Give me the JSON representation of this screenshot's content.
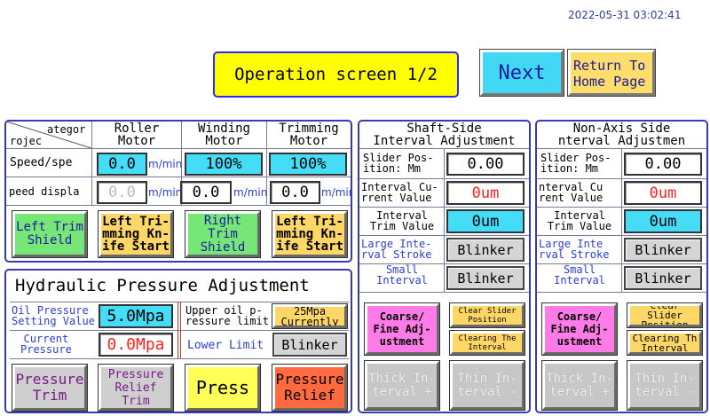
{
  "header": {
    "timestamp": "2022-05-31 03:02:41",
    "title": "Operation screen 1/2",
    "next_label": "Next",
    "return_line1": "Return To",
    "return_line2": "Home Page"
  },
  "motor_panel": {
    "corner_top": "ategor",
    "corner_bottom": "rojec",
    "columns": [
      {
        "line1": "Roller",
        "line2": "Motor"
      },
      {
        "line1": "Winding",
        "line2": "Motor"
      },
      {
        "line1": "Trimming",
        "line2": "Motor"
      }
    ],
    "speed_label": "Speed/spe",
    "speed_values": [
      "0.0",
      "100%",
      "100%"
    ],
    "speed_unit": "m/min",
    "display_label": "peed displa",
    "display_values": [
      "0.0",
      "0.0",
      "0.0"
    ],
    "display_unit": "m/min",
    "buttons": [
      {
        "line1": "Left Trim",
        "line2": "Shield"
      },
      {
        "line1": "Left Tri-",
        "line2": "mming Kn-",
        "line3": "ife Start"
      },
      {
        "line1": "Right Trim",
        "line2": "Shield"
      },
      {
        "line1": "Left Tri-",
        "line2": "mming Kn-",
        "line3": "ife Start"
      }
    ]
  },
  "hydraulic_panel": {
    "title": "Hydraulic Pressure Adjustment",
    "oil_label1": "Oil Pressure",
    "oil_label2": "Setting Value",
    "oil_value": "5.0Mpa",
    "upper_label1": "Upper oil p-",
    "upper_label2": "ressure limit",
    "upper_value1": "25Mpa",
    "upper_value2": "Currently",
    "current_label1": "Current",
    "current_label2": "Pressure",
    "current_value": "0.0Mpa",
    "lower_label": "Lower Limit",
    "lower_value": "Blinker",
    "buttons": [
      {
        "line1": "Pressure",
        "line2": "Trim"
      },
      {
        "line1": "Pressure",
        "line2": "Relief Trim"
      },
      {
        "line1": "Press"
      },
      {
        "line1": "Pressure",
        "line2": "Relief"
      }
    ]
  },
  "shaft_panel": {
    "title1": "Shaft-Side",
    "title2": "Interval Adjustment",
    "slider_label1": "Slider Pos-",
    "slider_label2": "ition: Mm",
    "slider_value": "0.00",
    "current_label1": "Interval Cu-",
    "current_label2": "rrent Value",
    "current_value": "0um",
    "trim_label1": "Interval",
    "trim_label2": "Trim Value",
    "trim_value": "0um",
    "large_label1": "Large Inte-",
    "large_label2": "rval Stroke",
    "large_value": "Blinker",
    "small_label1": "Small",
    "small_label2": "Interval",
    "small_value": "Blinker",
    "coarse_line1": "Coarse/",
    "coarse_line2": "Fine Adj-",
    "coarse_line3": "ustment",
    "clear_line1": "Clear Slider",
    "clear_line2": "Position",
    "clearing_line1": "Clearing The",
    "clearing_line2": "Interval",
    "thick_line1": "Thick In-",
    "thick_line2": "terval +",
    "thin_line1": "Thin In-",
    "thin_line2": "terval -"
  },
  "nonaxis_panel": {
    "title1": "Non-Axis Side",
    "title2": "nterval Adjustmen",
    "slider_label1": "Slider Pos-",
    "slider_label2": "ition: Mm",
    "slider_value": "0.00",
    "current_label1": "nterval Cu",
    "current_label2": "rent Value",
    "current_value": "0um",
    "trim_label1": "Interval",
    "trim_label2": "Trim Value",
    "trim_value": "0um",
    "large_label1": "Large Inte",
    "large_label2": "rval Stroke",
    "large_value": "Blinker",
    "small_label1": "Small",
    "small_label2": "Interval",
    "small_value": "Blinker",
    "coarse_line1": "Coarse/",
    "coarse_line2": "Fine Adj-",
    "coarse_line3": "ustment",
    "clear_line1": "Clear Slider",
    "clear_line2": "Position",
    "clearing_line1": "Clearing Th",
    "clearing_line2": "Interval",
    "thick_line1": "Thick In-",
    "thick_line2": "terval +",
    "thin_line1": "Thin In-",
    "thin_line2": "terval -"
  }
}
